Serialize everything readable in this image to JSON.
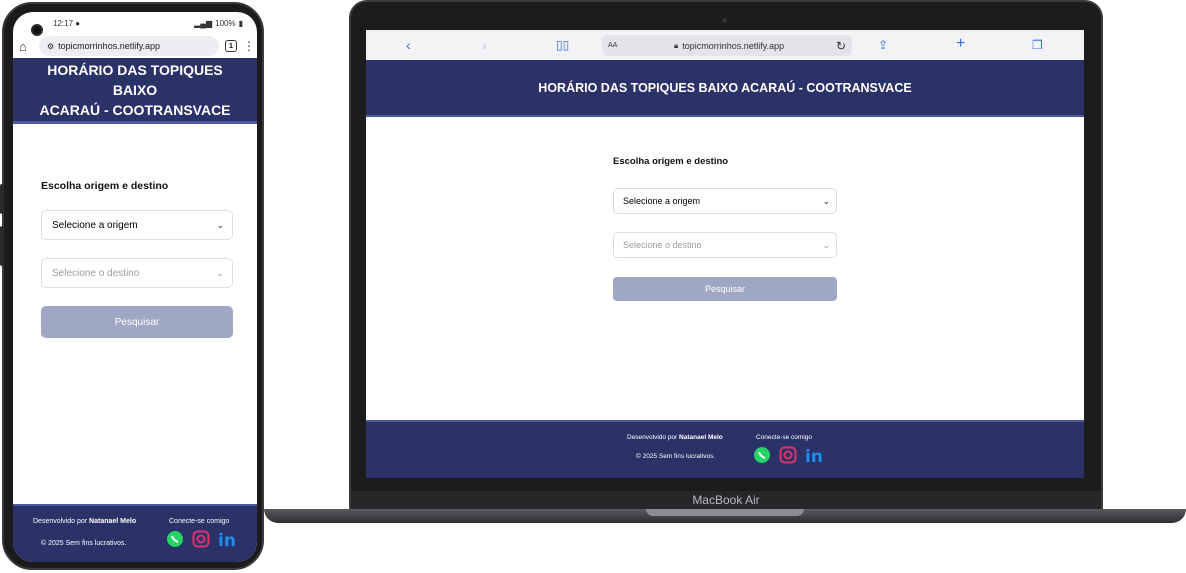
{
  "phone": {
    "status": {
      "time": "12:17",
      "battery": "100%"
    },
    "url": "topicmorrinhos.netlify.app",
    "tab_count": "1"
  },
  "laptop": {
    "aa_label": "AA",
    "url": "topicmorrinhos.netlify.app",
    "brand": "MacBook Air"
  },
  "page": {
    "title": "HORÁRIO DAS TOPIQUES BAIXO ACARAÚ - COOTRANSVACE",
    "title_mobile_line1": "HORÁRIO DAS TOPIQUES BAIXO",
    "title_mobile_line2": "ACARAÚ - COOTRANSVACE",
    "form": {
      "heading": "Escolha origem e destino",
      "origin_select": "Selecione a origem",
      "destination_select": "Selecione o destino",
      "search_button": "Pesquisar"
    },
    "footer": {
      "developed_by": "Desenvolvido por",
      "developer": "Natanael Melo",
      "connect": "Conecte-se comigo",
      "copyright": "© 2025 Sem fins lucrativos."
    }
  },
  "colors": {
    "header_bg": "#2b3268",
    "button_bg": "#9ea7c4",
    "whatsapp": "#25d366",
    "instagram": "#e1306c",
    "linkedin": "#0a66c2"
  }
}
